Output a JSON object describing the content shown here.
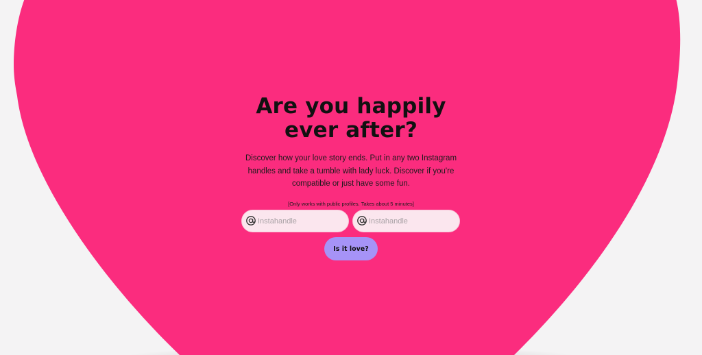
{
  "hero": {
    "headline_line1": "Are you happily",
    "headline_line2": "ever after?",
    "description": "Discover how your love story ends. Put in any two Instagram handles and take a tumble with lady luck. Discover if you're compatible or just have some fun.",
    "note": "[Only works with public profiles. Takes about 5 minutes]"
  },
  "form": {
    "handle_1_placeholder": "Instahandle",
    "handle_2_placeholder": "Instahandle",
    "submit_label": "Is it love?"
  },
  "colors": {
    "background": "#f4f3f4",
    "heart": "#fb2c7e",
    "input_fill": "#fbe6ee",
    "button": "#a693f7",
    "text": "#111111"
  },
  "icons": {
    "field_prefix": "at-sign-icon"
  }
}
